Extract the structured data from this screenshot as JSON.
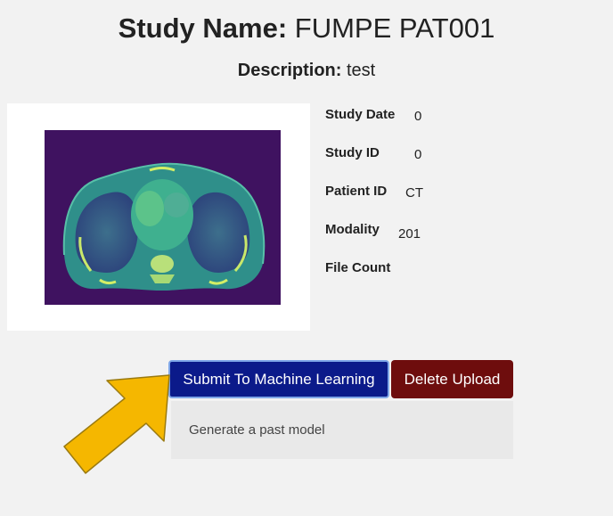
{
  "study": {
    "name_label": "Study Name:",
    "name_value": "FUMPE PAT001",
    "description_label": "Description:",
    "description_value": "test"
  },
  "meta": {
    "study_date": {
      "label": "Study Date",
      "value": "0"
    },
    "study_id": {
      "label": "Study ID",
      "value": "0"
    },
    "patient_id": {
      "label": "Patient ID",
      "value": "CT"
    },
    "modality": {
      "label": "Modality",
      "value": "201"
    },
    "file_count": {
      "label": "File Count",
      "value": ""
    }
  },
  "actions": {
    "submit_label": "Submit To Machine Learning",
    "delete_label": "Delete Upload"
  },
  "panel": {
    "text": "Generate a past model"
  },
  "colors": {
    "submit_button": "#0b1a8a",
    "delete_button": "#6e0d0d",
    "arrow": "#f5b700",
    "scan_background": "#3f1260"
  },
  "icons": {
    "annotation_arrow": "arrow-icon"
  }
}
